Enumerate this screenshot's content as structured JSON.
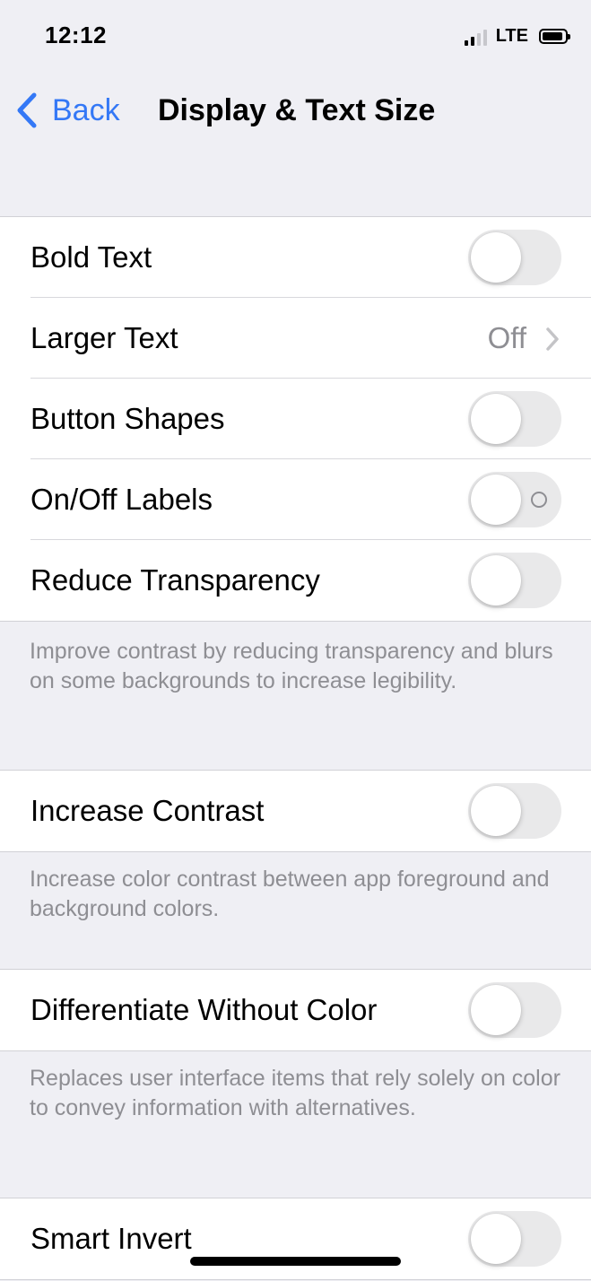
{
  "status_bar": {
    "time": "12:12",
    "network": "LTE",
    "signal_bars_active": 2,
    "signal_bars_total": 4,
    "battery_level": 0.85
  },
  "nav": {
    "back_label": "Back",
    "title": "Display & Text Size"
  },
  "groups": [
    {
      "rows": [
        {
          "label": "Bold Text",
          "type": "toggle",
          "on": false
        },
        {
          "label": "Larger Text",
          "type": "disclosure",
          "value": "Off"
        },
        {
          "label": "Button Shapes",
          "type": "toggle",
          "on": false
        },
        {
          "label": "On/Off Labels",
          "type": "toggle",
          "on": false,
          "shows_off_label": true
        },
        {
          "label": "Reduce Transparency",
          "type": "toggle",
          "on": false
        }
      ],
      "footer": "Improve contrast by reducing transparency and blurs on some backgrounds to increase legibility."
    },
    {
      "rows": [
        {
          "label": "Increase Contrast",
          "type": "toggle",
          "on": false
        }
      ],
      "footer": "Increase color contrast between app foreground and background colors."
    },
    {
      "rows": [
        {
          "label": "Differentiate Without Color",
          "type": "toggle",
          "on": false
        }
      ],
      "footer": "Replaces user interface items that rely solely on color to convey information with alternatives."
    },
    {
      "rows": [
        {
          "label": "Smart Invert",
          "type": "toggle",
          "on": false
        }
      ]
    }
  ],
  "colors": {
    "accent": "#3478f6",
    "background": "#efeff4",
    "toggle_off": "#e9e9ea",
    "secondary_text": "#8e8e93"
  }
}
